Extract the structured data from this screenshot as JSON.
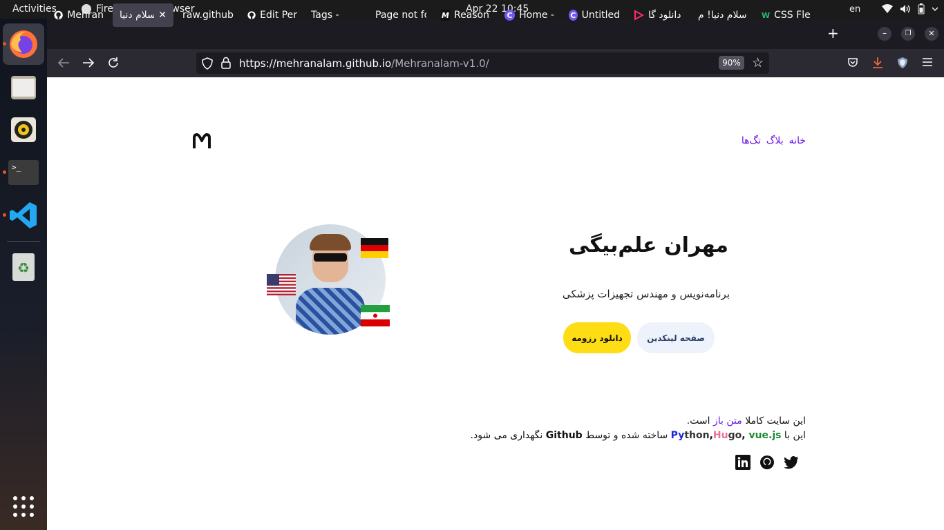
{
  "system": {
    "activities": "Activities",
    "app_name": "Firefox Web Browser",
    "datetime": "Apr 22  10:45",
    "lang": "en"
  },
  "tabs": [
    {
      "label": "Mehran",
      "icon": "github-icon"
    },
    {
      "label": "سلام دنیا!",
      "icon": "",
      "active": true
    },
    {
      "label": "raw.github",
      "icon": ""
    },
    {
      "label": "Edit Per",
      "icon": "github-icon"
    },
    {
      "label": "Tags -",
      "icon": ""
    },
    {
      "label": "Page not fo",
      "icon": ""
    },
    {
      "label": "Reason",
      "icon": "m-icon"
    },
    {
      "label": "Home -",
      "icon": "c-icon"
    },
    {
      "label": "Untitled",
      "icon": "c-icon"
    },
    {
      "label": "دانلود گا",
      "icon": "play-icon"
    },
    {
      "label": "سلام دنیا! م",
      "icon": ""
    },
    {
      "label": "CSS Fle",
      "icon": "w-icon"
    }
  ],
  "url": {
    "host": "https://mehranalam.github.io",
    "path": "/Mehranalam-v1.0/"
  },
  "zoom": "90%",
  "site": {
    "nav": [
      "تگ‌ها",
      "بلاگ",
      "خانه"
    ],
    "name": "مهران علم‌بیگی",
    "subtitle": "برنامه‌نویس و مهندس تجهیزات پزشکی",
    "btn_resume": "دانلود رزومه",
    "btn_linkedin": "صفحه لینکدین",
    "footer": {
      "line1_a": "این سایت کاملا ",
      "line1_link": "متن باز",
      "line1_b": " است.",
      "line2_a": "این با ",
      "py1": "Py",
      "py2": "thon",
      "comma": ",",
      "hu1": "Hu",
      "hu2": "go",
      "sep": ", ",
      "vue": "vue.js",
      "line2_b": " ساخته شده و توسط ",
      "github": "Github",
      "line2_c": " نگهداری می شود."
    }
  },
  "colors": {
    "accent": "#6b16e8",
    "resume_bg": "#ffdd15",
    "linkedin_bg": "#eef3fb"
  }
}
